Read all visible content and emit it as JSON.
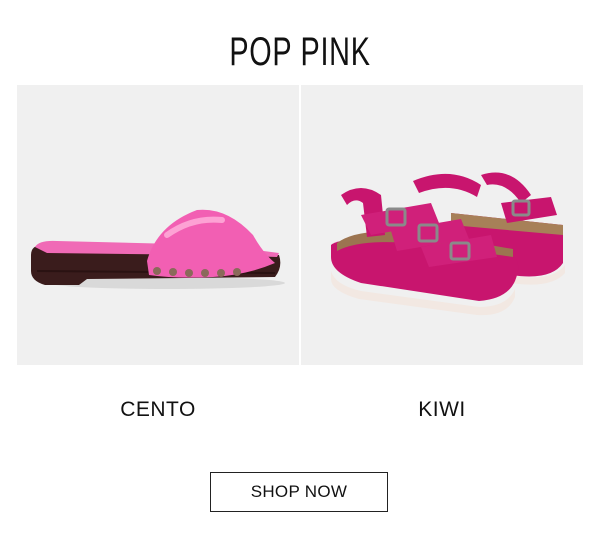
{
  "header": {
    "title": "POP PINK"
  },
  "products": [
    {
      "name": "CENTO",
      "image": "pink-patent-studded-clog-sandal",
      "color": "#f05fb0"
    },
    {
      "name": "KIWI",
      "image": "magenta-buckled-platform-sandals",
      "color": "#c8156e"
    }
  ],
  "cta": {
    "label": "SHOP NOW"
  },
  "colors": {
    "panel_background": "#f0f0f0",
    "text": "#111111"
  }
}
